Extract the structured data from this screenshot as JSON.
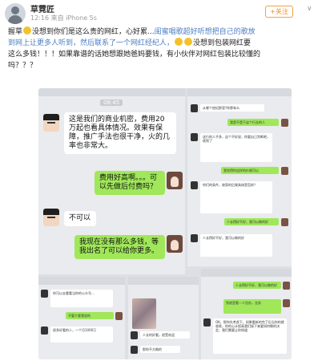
{
  "header": {
    "username": "草霓匠",
    "meta": "12:16 来自 iPhone 5s",
    "follow_label": "+关注",
    "chevron": "∨"
  },
  "post": {
    "p1": "握草",
    "p2": "没想到你们是这么贵的网红，心好累...",
    "p3": "闺蜜唱歌超好听想把自己的歌放",
    "p4": "到网上让更多人听到，然后联系了一个网红经纪人，",
    "p5": "没想到包装网红要",
    "p6": "这么多钱！！！如果靠谱的话她想跟她爸妈要钱，有小伙伴对网红包装比较懂的",
    "p7": "吗？？？"
  },
  "chat": {
    "time": "08:45",
    "m1": "这是我们的商业机密，费用20万起也看具体情况。效果有保障，推广手法也很干净，火的几率也非常大。",
    "m2": "费用好高啊。。。可以先做后付费吗？",
    "m3": "不可以",
    "m4": "我现在没有那么多钱，等我出名了可以给你更多。"
  },
  "mini_chat": {
    "a1": "从哪个经纪那里?你那有么",
    "a2": "我是不是干这个行业的人",
    "a3": "这行的人不多，这个不好说，你要自己判断吧，收到了",
    "a4": "我觉得你这样的价格可以",
    "a5": "你们的条件，收获的后果具体是怎样？",
    "a6": "人长得好不好，我可以做的好",
    "a7": "到底是看一人包办，业务",
    "a8": "OK，那你先考虑下，如果看新的完了后当你的就收款，你的心计很高我们接下来要如何做的决定，我们需要让你知道",
    "b1": "你可以去看看当你的公众号...",
    "b2": "很多好看的人，一个月1000万",
    "b3": "不要介意我说的",
    "c1": "人长的好看，很受欢迎",
    "c2": "那你不大概的"
  }
}
